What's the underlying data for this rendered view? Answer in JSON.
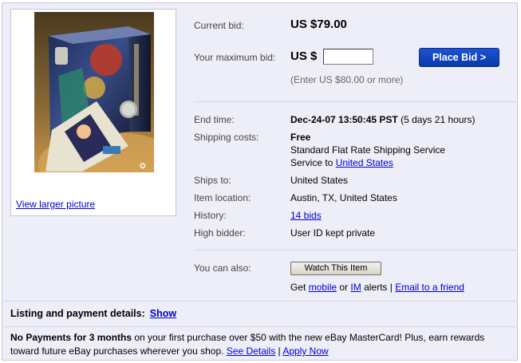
{
  "photo": {
    "link": "View larger picture"
  },
  "bid": {
    "current_label": "Current bid:",
    "current_value": "US $79.00",
    "max_label": "Your maximum bid:",
    "currency": "US $",
    "input_value": "",
    "place_bid_label": "Place Bid >",
    "hint": "(Enter US $80.00 or more)"
  },
  "details": {
    "end_time_label": "End time:",
    "end_time_bold": "Dec-24-07 13:50:45 PST",
    "end_time_rest": " (5 days 21 hours)",
    "shipping_label": "Shipping costs:",
    "shipping_free": "Free",
    "shipping_service": "Standard Flat Rate Shipping Service",
    "service_to": "Service to ",
    "service_to_link": "United States",
    "ships_to_label": "Ships to:",
    "ships_to_value": "United States",
    "location_label": "Item location:",
    "location_value": "Austin, TX, United States",
    "history_label": "History:",
    "history_link": "14 bids",
    "high_bidder_label": "High bidder:",
    "high_bidder_value": "User ID kept private"
  },
  "also": {
    "label": "You can also:",
    "watch_button": "Watch This Item",
    "get": "Get ",
    "mobile_link": "mobile",
    "or": " or ",
    "im_link": "IM",
    "alerts": " alerts | ",
    "email_link": "Email to a friend"
  },
  "listing": {
    "label": "Listing and payment details:",
    "show_link": "Show"
  },
  "promo": {
    "bold": "No Payments for 3 months",
    "text": " on your first purchase over $50 with the new eBay MasterCard! Plus, earn rewards toward future eBay purchases wherever you shop. ",
    "details_link": "See Details",
    "sep": " | ",
    "apply_link": "Apply Now"
  },
  "colors": {
    "background": "#eeeef8",
    "link": "#0000cc",
    "button_blue": "#1c53d6"
  }
}
